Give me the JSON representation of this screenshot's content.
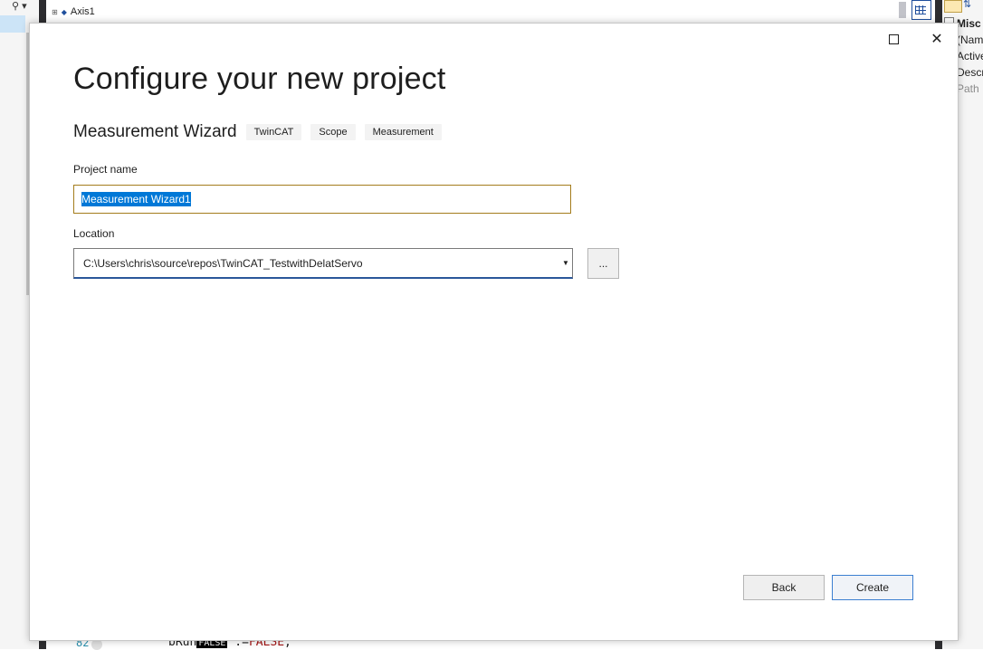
{
  "background": {
    "search_glyph": "⚲",
    "tree_item": "Axis1",
    "properties": {
      "category": "Misc",
      "items": [
        "(Nam",
        "Active",
        "Descr",
        "Path"
      ]
    },
    "code_line": {
      "line_number": "82",
      "identifier": "bRun",
      "value_badge": "FALSE",
      "assign": " :=",
      "value": "FALSE",
      "terminator": ";"
    }
  },
  "dialog": {
    "title": "Configure your new project",
    "template": {
      "name": "Measurement Wizard",
      "tags": [
        "TwinCAT",
        "Scope",
        "Measurement"
      ]
    },
    "project_name": {
      "label": "Project name",
      "value": "Measurement Wizard1"
    },
    "location": {
      "label": "Location",
      "value": "C:\\Users\\chris\\source\\repos\\TwinCAT_TestwithDelatServo"
    },
    "browse_label": "...",
    "buttons": {
      "back": "Back",
      "create": "Create"
    },
    "window_controls": {
      "close_glyph": "✕"
    }
  },
  "colors": {
    "selection": "#0078d7",
    "input_focus_border": "#a47c1c",
    "primary_button_border": "#3c7fd1",
    "tag_background": "#f3f3f3"
  }
}
